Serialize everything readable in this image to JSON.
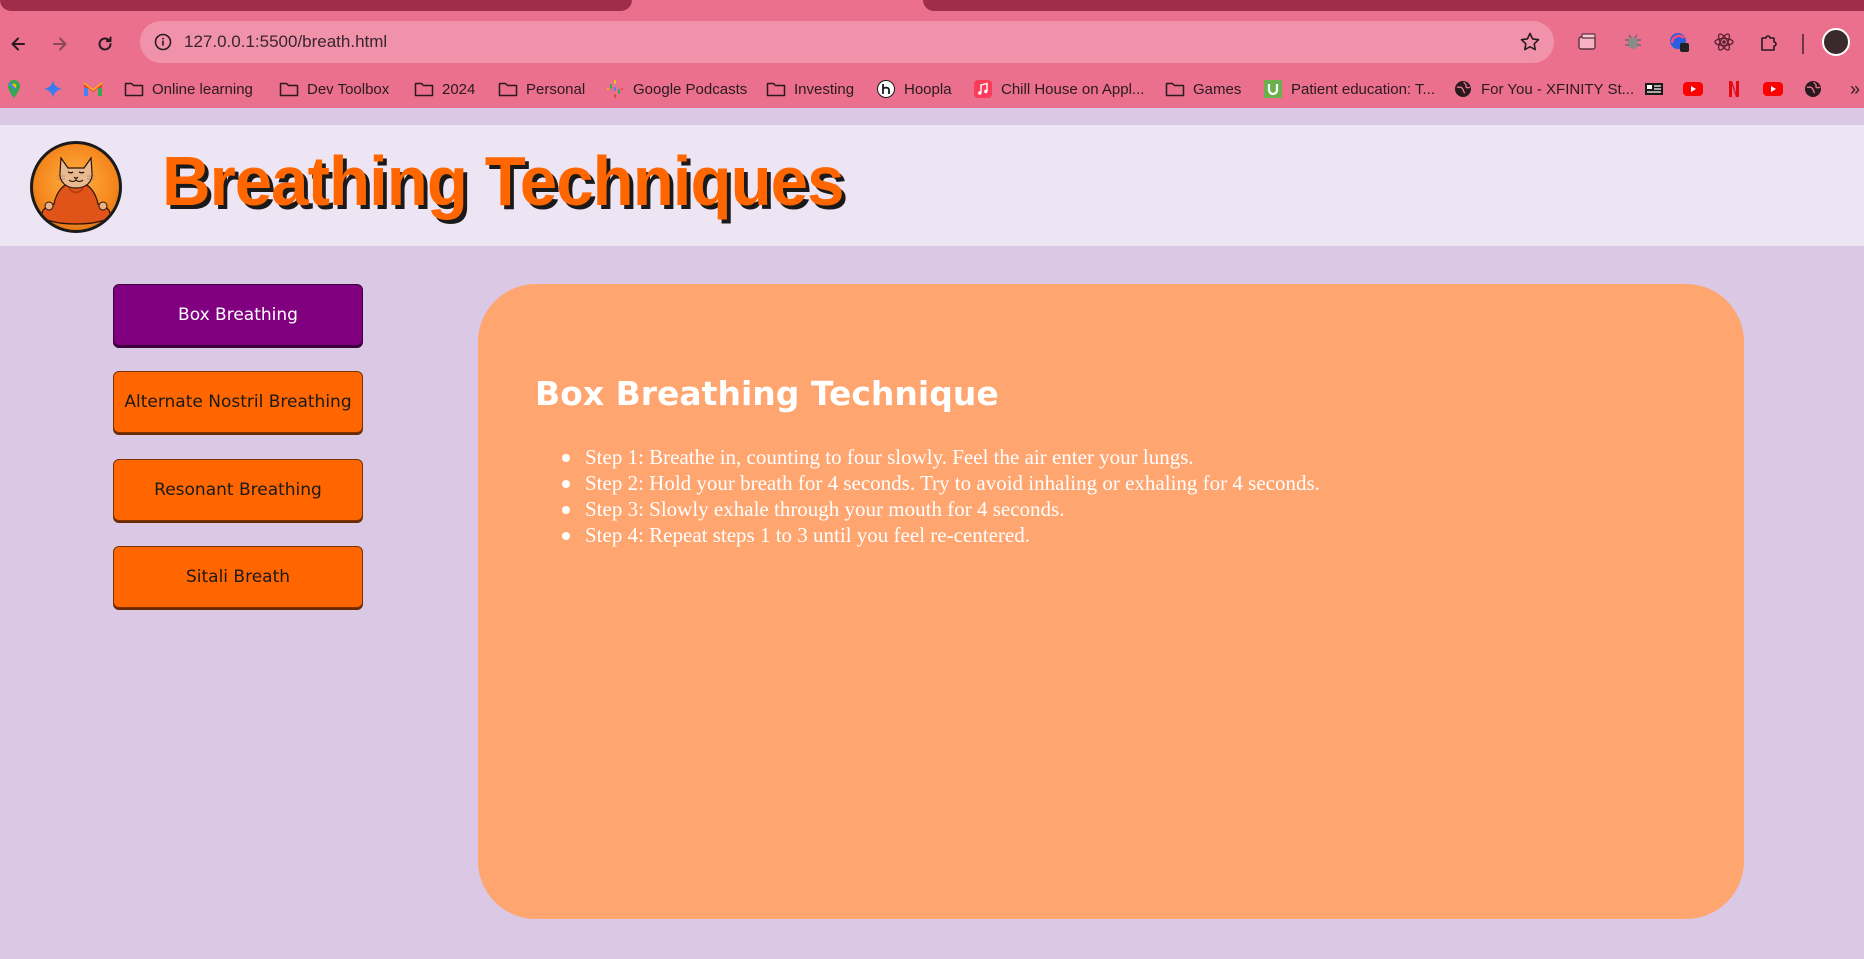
{
  "browser": {
    "url": "127.0.0.1:5500/breath.html",
    "bookmarks": [
      {
        "label": "Online learning",
        "icon": "folder-icon"
      },
      {
        "label": "Dev Toolbox",
        "icon": "folder-icon"
      },
      {
        "label": "2024",
        "icon": "folder-icon"
      },
      {
        "label": "Personal",
        "icon": "folder-icon"
      },
      {
        "label": "Google Podcasts",
        "icon": "google-podcasts-icon"
      },
      {
        "label": "Investing",
        "icon": "folder-icon"
      },
      {
        "label": "Hoopla",
        "icon": "hoopla-icon"
      },
      {
        "label": "Chill House on Appl...",
        "icon": "apple-music-icon"
      },
      {
        "label": "Games",
        "icon": "folder-icon"
      },
      {
        "label": "Patient education: T...",
        "icon": "uptodate-icon"
      },
      {
        "label": "For You - XFINITY St...",
        "icon": "globe-icon"
      }
    ],
    "more_label": "»",
    "colors": {
      "chrome": "#ea708e",
      "tab_dark": "#a02d4a",
      "omnibox": "#f093aa"
    }
  },
  "header": {
    "title": "Breathing Techniques",
    "logo": "meditating-cat-logo"
  },
  "sidebar": {
    "buttons": [
      {
        "label": "Box Breathing",
        "active": true
      },
      {
        "label": "Alternate Nostril Breathing",
        "active": false
      },
      {
        "label": "Resonant Breathing",
        "active": false
      },
      {
        "label": "Sitali Breath",
        "active": false
      }
    ]
  },
  "content": {
    "title": "Box Breathing Technique",
    "steps": [
      "Step 1: Breathe in, counting to four slowly. Feel the air enter your lungs.",
      "Step 2: Hold your breath for 4 seconds. Try to avoid inhaling or exhaling for 4 seconds.",
      "Step 3: Slowly exhale through your mouth for 4 seconds.",
      "Step 4: Repeat steps 1 to 3 until you feel re-centered."
    ]
  },
  "colors": {
    "page_bg": "#dac8e4",
    "header_bg": "#ede5f3",
    "accent_orange": "#ff6600",
    "active_purple": "#800080",
    "card_bg": "#fea570"
  }
}
